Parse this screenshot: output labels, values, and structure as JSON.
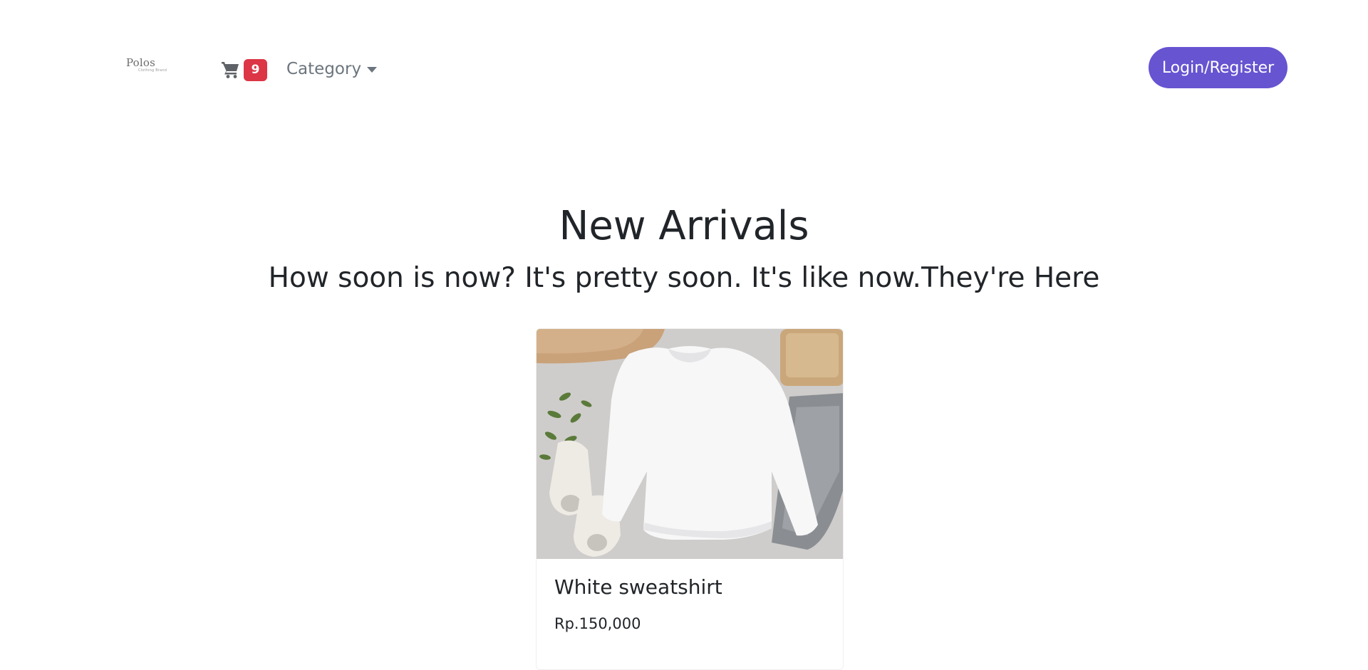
{
  "navbar": {
    "brand_name": "Polos",
    "brand_tagline": "Clothing Brand",
    "cart_count": "9",
    "category_label": "Category",
    "login_label": "Login/Register"
  },
  "hero": {
    "title": "New Arrivals",
    "subtitle": "How soon is now? It's pretty soon. It's like now.They're Here"
  },
  "products": [
    {
      "name": "White sweatshirt",
      "price": "Rp.150,000"
    }
  ],
  "colors": {
    "primary_button": "#6654d1",
    "badge": "#dc3545",
    "muted_text": "#6c757d",
    "heading_text": "#212529"
  },
  "icons": {
    "cart": "shopping-cart-icon",
    "category_caret": "caret-down-icon"
  }
}
